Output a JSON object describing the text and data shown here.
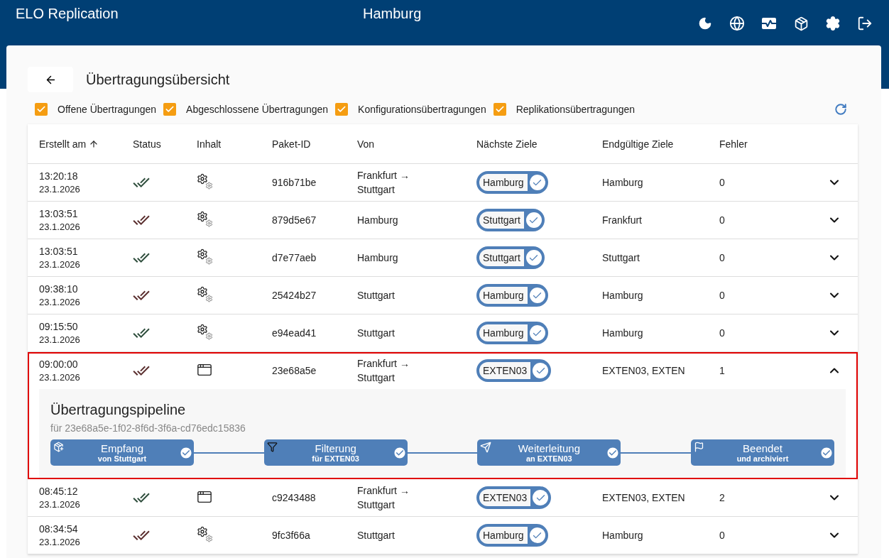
{
  "app_title": "ELO Replication",
  "location": "Hamburg",
  "page_title": "Übertragungsübersicht",
  "filters": [
    {
      "label": "Offene Übertragungen",
      "checked": true
    },
    {
      "label": "Abgeschlossene Übertragungen",
      "checked": true
    },
    {
      "label": "Konfigurationsübertragungen",
      "checked": true
    },
    {
      "label": "Replikationsübertragungen",
      "checked": true
    }
  ],
  "table": {
    "columns": [
      "Erstellt am",
      "Status",
      "Inhalt",
      "Paket-ID",
      "Von",
      "Nächste Ziele",
      "Endgültige Ziele",
      "Fehler"
    ],
    "rows": [
      {
        "time": "13:20:18",
        "date": "23.1.2026",
        "status": {
          "color": "#2e4d3c"
        },
        "content": {
          "kind": "config"
        },
        "package_id": "916b71be",
        "from": "Frankfurt →\nStuttgart",
        "next_target": "Hamburg",
        "final_targets": "Hamburg",
        "errors": "0",
        "expanded": false,
        "selected": false
      },
      {
        "time": "13:03:51",
        "date": "23.1.2026",
        "status": {
          "color": "#5a2e2e"
        },
        "content": {
          "kind": "config"
        },
        "package_id": "879d5e67",
        "from": "Hamburg",
        "next_target": "Stuttgart",
        "final_targets": "Frankfurt",
        "errors": "0",
        "expanded": false,
        "selected": false
      },
      {
        "time": "13:03:51",
        "date": "23.1.2026",
        "status": {
          "color": "#2e4d3c"
        },
        "content": {
          "kind": "config"
        },
        "package_id": "d7e77aeb",
        "from": "Hamburg",
        "next_target": "Stuttgart",
        "final_targets": "Stuttgart",
        "errors": "0",
        "expanded": false,
        "selected": false
      },
      {
        "time": "09:38:10",
        "date": "23.1.2026",
        "status": {
          "color": "#5a2e2e"
        },
        "content": {
          "kind": "config"
        },
        "package_id": "25424b27",
        "from": "Stuttgart",
        "next_target": "Hamburg",
        "final_targets": "Hamburg",
        "errors": "0",
        "expanded": false,
        "selected": false
      },
      {
        "time": "09:15:50",
        "date": "23.1.2026",
        "status": {
          "color": "#2e4d3c"
        },
        "content": {
          "kind": "config"
        },
        "package_id": "e94ead41",
        "from": "Stuttgart",
        "next_target": "Hamburg",
        "final_targets": "Hamburg",
        "errors": "0",
        "expanded": false,
        "selected": false
      },
      {
        "time": "09:00:00",
        "date": "23.1.2026",
        "status": {
          "color": "#5a2e2e"
        },
        "content": {
          "kind": "replication"
        },
        "package_id": "23e68a5e",
        "from": "Frankfurt →\nStuttgart",
        "next_target": "EXTEN03",
        "final_targets": "EXTEN03, EXTEN",
        "errors": "1",
        "expanded": true,
        "selected": true,
        "pipeline": {
          "title": "Übertragungspipeline",
          "subtitle": "für 23e68a5e-1f02-8f6d-3f6a-cd76edc15836",
          "steps": [
            {
              "kind": "receive",
              "title": "Empfang",
              "detail": "von Stuttgart",
              "done": true
            },
            {
              "kind": "filter",
              "title": "Filterung",
              "detail": "für EXTEN03",
              "done": true
            },
            {
              "kind": "forward",
              "title": "Weiterleitung",
              "detail": "an EXTEN03",
              "done": true
            },
            {
              "kind": "finish",
              "title": "Beendet",
              "detail": "und archiviert",
              "done": true
            }
          ]
        }
      },
      {
        "time": "08:45:12",
        "date": "23.1.2026",
        "status": {
          "color": "#2e4d3c"
        },
        "content": {
          "kind": "replication"
        },
        "package_id": "c9243488",
        "from": "Frankfurt →\nStuttgart",
        "next_target": "EXTEN03",
        "final_targets": "EXTEN03, EXTEN",
        "errors": "2",
        "expanded": false,
        "selected": false
      },
      {
        "time": "08:34:54",
        "date": "23.1.2026",
        "status": {
          "color": "#5a2e2e"
        },
        "content": {
          "kind": "config"
        },
        "package_id": "9fc3f66a",
        "from": "Stuttgart",
        "next_target": "Hamburg",
        "final_targets": "Hamburg",
        "errors": "0",
        "expanded": false,
        "selected": false
      }
    ]
  }
}
